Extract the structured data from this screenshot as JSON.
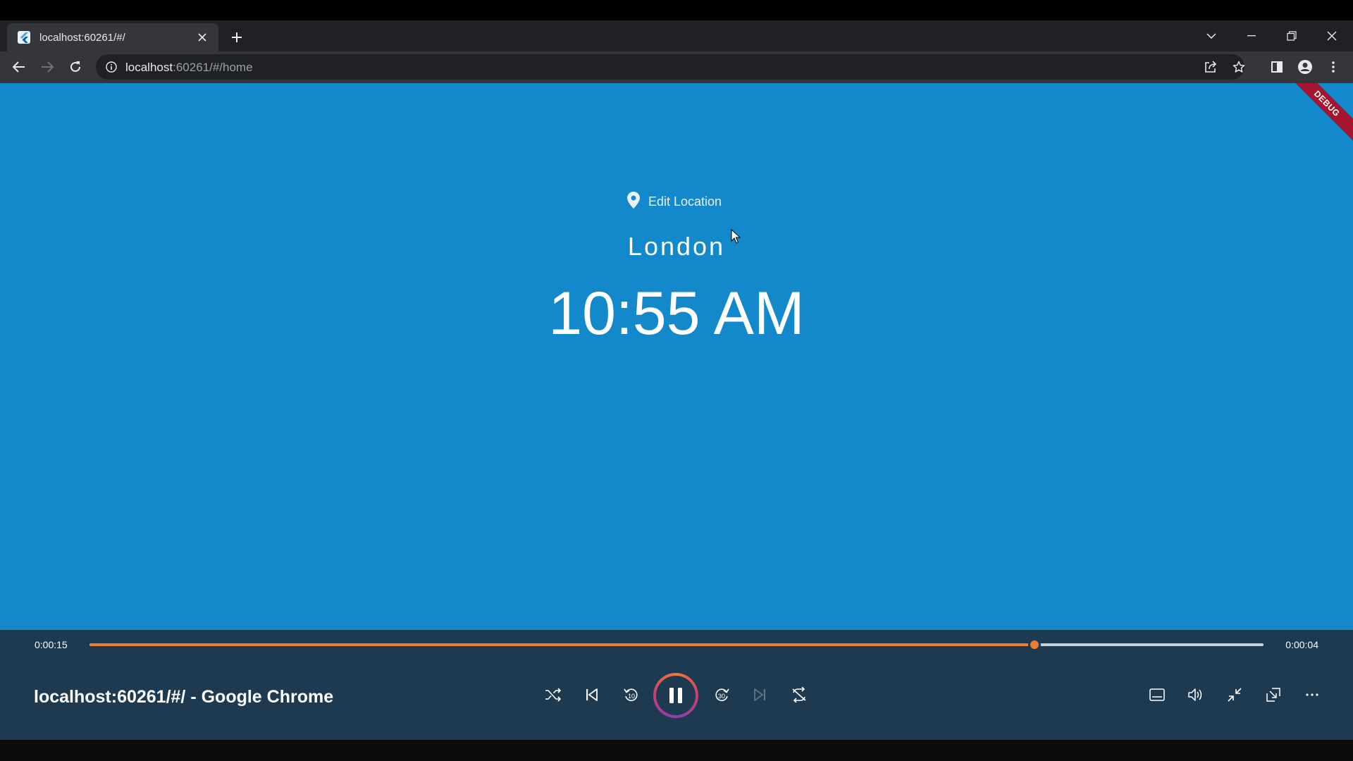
{
  "browser": {
    "tab_title": "localhost:60261/#/",
    "url_host": "localhost",
    "url_rest": ":60261/#/home"
  },
  "app": {
    "edit_location_label": "Edit Location",
    "location": "London",
    "time": "10:55 AM",
    "debug_banner": "DEBUG",
    "background_color": "#1388ca"
  },
  "player": {
    "elapsed": "0:00:15",
    "remaining": "0:00:04",
    "progress": 0.805,
    "title": "localhost:60261/#/ - Google Chrome",
    "accent_color": "#ee7d33",
    "controls_left": [
      "shuffle-icon",
      "previous-icon",
      "rewind-10-icon"
    ],
    "controls_right": [
      "forward-30-icon",
      "next-icon",
      "repeat-icon"
    ],
    "extra_controls": [
      "captions-icon",
      "volume-icon",
      "exit-fullscreen-icon",
      "miniplayer-icon",
      "more-icon"
    ]
  }
}
